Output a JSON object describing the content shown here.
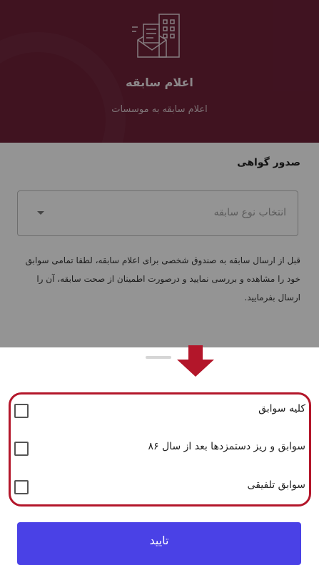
{
  "header": {
    "icon": "building-envelope-icon",
    "title": "اعلام سابقه",
    "subtitle": "اعلام سابقه به موسسات"
  },
  "form": {
    "section_title": "صدور گواهی",
    "select_placeholder": "انتخاب نوع سابقه",
    "description": "قبل از ارسال سابقه به صندوق شخصی برای اعلام سابقه، لطفا تمامی سوابق خود را مشاهده و بررسی نمایید و درصورت اطمینان از صحت سابقه، آن را ارسال بفرمایید."
  },
  "sheet": {
    "options": [
      {
        "label": "کلیه سوابق",
        "checked": false
      },
      {
        "label": "سوابق و ریز دستمزدها بعد از سال ۸۶",
        "checked": false
      },
      {
        "label": "سوابق تلفیقی",
        "checked": false
      }
    ],
    "confirm_label": "تایید"
  },
  "colors": {
    "header": "#6e2138",
    "accent_button": "#4a41e6",
    "highlight": "#b3162a"
  }
}
